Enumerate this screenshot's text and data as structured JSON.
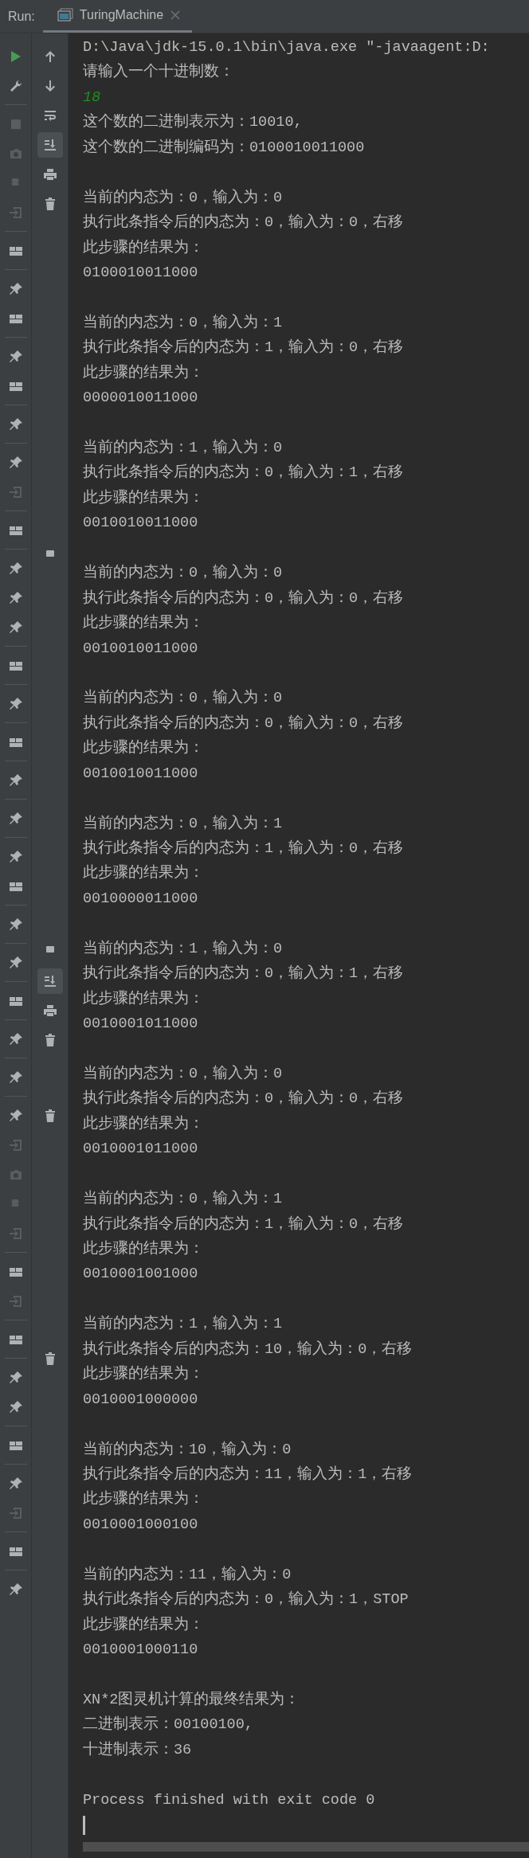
{
  "run_panel": {
    "label": "Run:",
    "tab": {
      "title": "TuringMachine",
      "selected": true
    }
  },
  "console": {
    "blocks": [
      [
        {
          "kind": "output",
          "text": "D:\\Java\\jdk-15.0.1\\bin\\java.exe \"-javaagent:D:"
        },
        {
          "kind": "output",
          "text": "请输入一个十进制数："
        },
        {
          "kind": "input",
          "text": "18"
        },
        {
          "kind": "output",
          "text": "这个数的二进制表示为：10010,"
        },
        {
          "kind": "output",
          "text": "这个数的二进制编码为：0100010011000"
        }
      ],
      [
        {
          "kind": "output",
          "text": "当前的内态为：0，输入为：0"
        },
        {
          "kind": "output",
          "text": "执行此条指令后的内态为：0，输入为：0，右移"
        },
        {
          "kind": "output",
          "text": "此步骤的结果为："
        },
        {
          "kind": "output",
          "text": "0100010011000"
        }
      ],
      [
        {
          "kind": "output",
          "text": "当前的内态为：0，输入为：1"
        },
        {
          "kind": "output",
          "text": "执行此条指令后的内态为：1，输入为：0，右移"
        },
        {
          "kind": "output",
          "text": "此步骤的结果为："
        },
        {
          "kind": "output",
          "text": "0000010011000"
        }
      ],
      [
        {
          "kind": "output",
          "text": "当前的内态为：1，输入为：0"
        },
        {
          "kind": "output",
          "text": "执行此条指令后的内态为：0，输入为：1，右移"
        },
        {
          "kind": "output",
          "text": "此步骤的结果为："
        },
        {
          "kind": "output",
          "text": "0010010011000"
        }
      ],
      [
        {
          "kind": "output",
          "text": "当前的内态为：0，输入为：0"
        },
        {
          "kind": "output",
          "text": "执行此条指令后的内态为：0，输入为：0，右移"
        },
        {
          "kind": "output",
          "text": "此步骤的结果为："
        },
        {
          "kind": "output",
          "text": "0010010011000"
        }
      ],
      [
        {
          "kind": "output",
          "text": "当前的内态为：0，输入为：0"
        },
        {
          "kind": "output",
          "text": "执行此条指令后的内态为：0，输入为：0，右移"
        },
        {
          "kind": "output",
          "text": "此步骤的结果为："
        },
        {
          "kind": "output",
          "text": "0010010011000"
        }
      ],
      [
        {
          "kind": "output",
          "text": "当前的内态为：0，输入为：1"
        },
        {
          "kind": "output",
          "text": "执行此条指令后的内态为：1，输入为：0，右移"
        },
        {
          "kind": "output",
          "text": "此步骤的结果为："
        },
        {
          "kind": "output",
          "text": "0010000011000"
        }
      ],
      [
        {
          "kind": "output",
          "text": "当前的内态为：1，输入为：0"
        },
        {
          "kind": "output",
          "text": "执行此条指令后的内态为：0，输入为：1，右移"
        },
        {
          "kind": "output",
          "text": "此步骤的结果为："
        },
        {
          "kind": "output",
          "text": "0010001011000"
        }
      ],
      [
        {
          "kind": "output",
          "text": "当前的内态为：0，输入为：0"
        },
        {
          "kind": "output",
          "text": "执行此条指令后的内态为：0，输入为：0，右移"
        },
        {
          "kind": "output",
          "text": "此步骤的结果为："
        },
        {
          "kind": "output",
          "text": "0010001011000"
        }
      ],
      [
        {
          "kind": "output",
          "text": "当前的内态为：0，输入为：1"
        },
        {
          "kind": "output",
          "text": "执行此条指令后的内态为：1，输入为：0，右移"
        },
        {
          "kind": "output",
          "text": "此步骤的结果为："
        },
        {
          "kind": "output",
          "text": "0010001001000"
        }
      ],
      [
        {
          "kind": "output",
          "text": "当前的内态为：1，输入为：1"
        },
        {
          "kind": "output",
          "text": "执行此条指令后的内态为：10，输入为：0，右移"
        },
        {
          "kind": "output",
          "text": "此步骤的结果为："
        },
        {
          "kind": "output",
          "text": "0010001000000"
        }
      ],
      [
        {
          "kind": "output",
          "text": "当前的内态为：10，输入为：0"
        },
        {
          "kind": "output",
          "text": "执行此条指令后的内态为：11，输入为：1，右移"
        },
        {
          "kind": "output",
          "text": "此步骤的结果为："
        },
        {
          "kind": "output",
          "text": "0010001000100"
        }
      ],
      [
        {
          "kind": "output",
          "text": "当前的内态为：11，输入为：0"
        },
        {
          "kind": "output",
          "text": "执行此条指令后的内态为：0，输入为：1，STOP"
        },
        {
          "kind": "output",
          "text": "此步骤的结果为："
        },
        {
          "kind": "output",
          "text": "0010001000110"
        }
      ],
      [
        {
          "kind": "output",
          "text": "XN*2图灵机计算的最终结果为："
        },
        {
          "kind": "output",
          "text": "二进制表示：00100100,"
        },
        {
          "kind": "output",
          "text": "十进制表示：36"
        }
      ],
      [
        {
          "kind": "output",
          "text": "Process finished with exit code 0"
        }
      ]
    ]
  }
}
